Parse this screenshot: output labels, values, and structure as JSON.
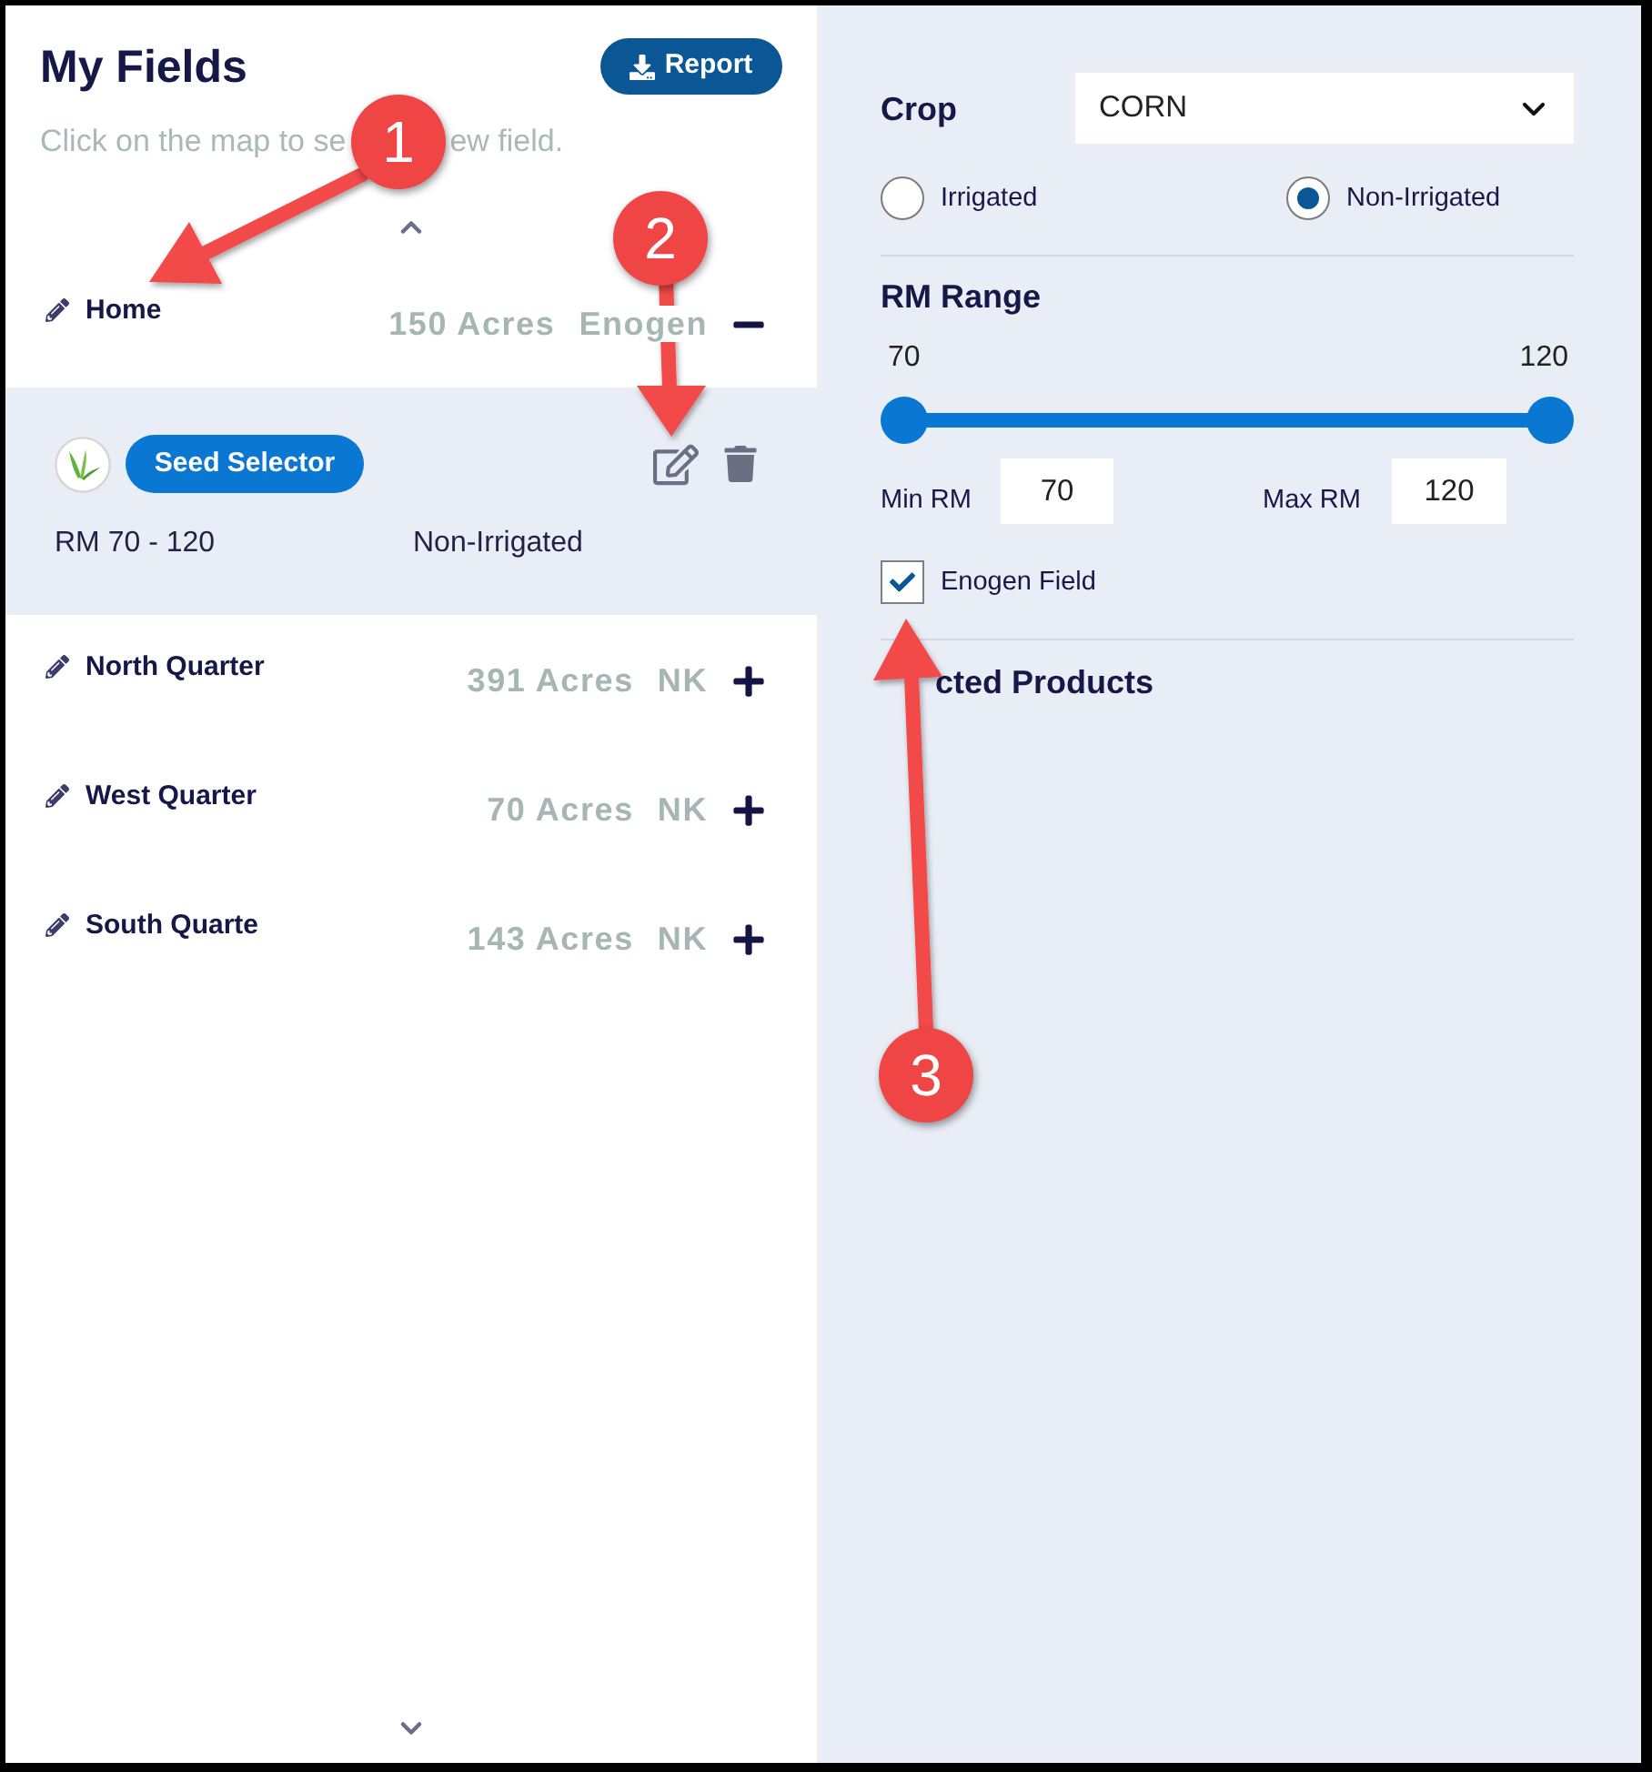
{
  "panel": {
    "title": "My Fields",
    "report_button": "Report",
    "hint_parts": [
      "Click on the map to se",
      "ew field."
    ]
  },
  "fields": [
    {
      "name": "Home",
      "acres": "150 Acres",
      "brand": "Enogen",
      "expanded": true,
      "detail": {
        "badge": "Seed Selector",
        "rm": "RM 70 - 120",
        "irrigation": "Non-Irrigated"
      }
    },
    {
      "name": "North Quarter",
      "acres": "391 Acres",
      "brand": "NK",
      "expanded": false
    },
    {
      "name": "West Quarter",
      "acres": "70 Acres",
      "brand": "NK",
      "expanded": false
    },
    {
      "name": "South Quarte",
      "acres": "143 Acres",
      "brand": "NK",
      "expanded": false
    }
  ],
  "settings": {
    "crop": {
      "label": "Crop",
      "value": "CORN"
    },
    "irrigation": [
      {
        "label": "Irrigated",
        "selected": false
      },
      {
        "label": "Non-Irrigated",
        "selected": true
      }
    ],
    "rm_range": {
      "title": "RM Range",
      "min_label": "70",
      "max_label": "120",
      "thumbs": [
        {
          "level": 0
        },
        {
          "level": 1
        }
      ]
    },
    "min_rm": {
      "label": "Min RM",
      "value": "70"
    },
    "max_rm": {
      "label": "Max RM",
      "value": "120"
    },
    "enogen_field": {
      "label": "Enogen Field",
      "checked": true
    },
    "products_title": "cted Products"
  },
  "annotations": [
    {
      "number": "1"
    },
    {
      "number": "2"
    },
    {
      "number": "3"
    }
  ]
}
